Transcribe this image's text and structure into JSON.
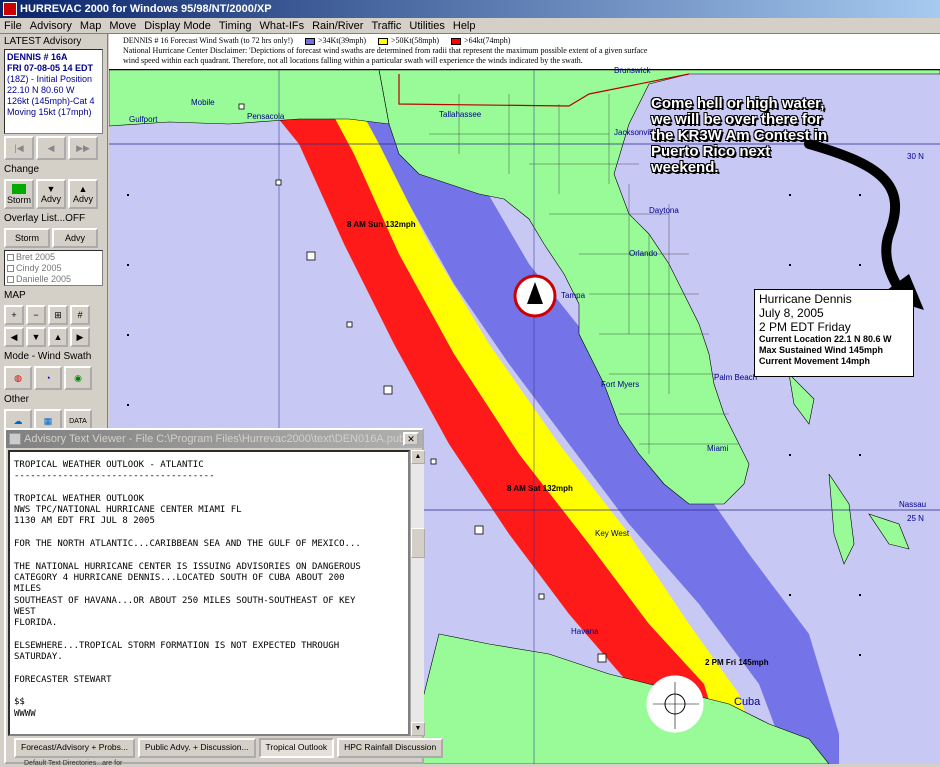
{
  "window": {
    "title": "HURREVAC 2000 for Windows 95/98/NT/2000/XP"
  },
  "menu": [
    "File",
    "Advisory",
    "Map",
    "Move",
    "Display Mode",
    "Timing",
    "What-IFs",
    "Rain/River",
    "Traffic",
    "Utilities",
    "Help"
  ],
  "left_panel": {
    "latest_label": "LATEST Advisory",
    "advisory_lines": [
      "DENNIS     # 16A",
      "FRI 07-08-05 14 EDT",
      "(18Z) - Initial Position",
      "22.10 N  80.60 W",
      "126kt (145mph)-Cat 4",
      "Moving 15kt (17mph)"
    ],
    "change_label": "Change",
    "change_buttons": [
      "Storm",
      "Advy",
      "Advy"
    ],
    "overlay_label": "Overlay List...OFF",
    "overlay_buttons": [
      "Storm",
      "Advy"
    ],
    "storms": [
      "Bret 2005",
      "Cindy 2005",
      "Danielle 2005"
    ],
    "map_label": "MAP",
    "mode_label": "Mode - Wind Swath",
    "other_label": "Other"
  },
  "disclaimer": {
    "heading": "DENNIS # 16     Forecast Wind Swath (to 72 hrs only!)",
    "legend": [
      {
        "label": ">34Kt(39mph)",
        "color": "#7070e0"
      },
      {
        "label": ">50Kt(58mph)",
        "color": "#ffff00"
      },
      {
        "label": ">64kt(74mph)",
        "color": "#ff0000"
      }
    ],
    "text1": "National Hurricane Center Disclaimer:  'Depictions of forecast wind swaths are determined from radii that represent the maximum possible extent of a given surface",
    "text2": "wind speed within each quadrant.  Therefore, not all locations falling within a particular swath will experience the winds indicated by the swath."
  },
  "map": {
    "cities": [
      "Mobile",
      "Pensacola",
      "Gulfport",
      "Tallahassee",
      "Jacksonville",
      "Daytona",
      "Orlando",
      "Tampa",
      "Fort Myers",
      "Palm Beach",
      "Miami",
      "Key West",
      "Havana",
      "Nassau",
      "Cuba",
      "Brunswick"
    ],
    "lat_labels": [
      "30 N",
      "25 N"
    ],
    "forecast_labels": [
      "8 AM  Sun 132mph",
      "8 AM  Sat 132mph",
      "2 PM  Fri 145mph"
    ]
  },
  "callout": {
    "text": "Come hell or high water, we will be over there for the KR3W Am Contest in Puerto Rico next weekend."
  },
  "info_box": {
    "name": "Hurricane Dennis",
    "date": "July 8, 2005",
    "time": "2 PM EDT Friday",
    "location": "Current Location 22.1 N  80.6 W",
    "wind": "Max Sustained Wind 145mph",
    "movement": "Current Movement 14mph"
  },
  "viewer": {
    "title": "Advisory Text Viewer - File C:\\Program Files\\Hurrevac2000\\text\\DEN016A.pub",
    "text": "TROPICAL WEATHER OUTLOOK - ATLANTIC\n-------------------------------------\n\nTROPICAL WEATHER OUTLOOK\nNWS TPC/NATIONAL HURRICANE CENTER MIAMI FL\n1130 AM EDT FRI JUL 8 2005\n\nFOR THE NORTH ATLANTIC...CARIBBEAN SEA AND THE GULF OF MEXICO...\n\nTHE NATIONAL HURRICANE CENTER IS ISSUING ADVISORIES ON DANGEROUS\nCATEGORY 4 HURRICANE DENNIS...LOCATED SOUTH OF CUBA ABOUT 200\nMILES\nSOUTHEAST OF HAVANA...OR ABOUT 250 MILES SOUTH-SOUTHEAST OF KEY\nWEST\nFLORIDA.\n\nELSEWHERE...TROPICAL STORM FORMATION IS NOT EXPECTED THROUGH\nSATURDAY.\n\nFORECASTER STEWART\n\n$$\nWWWW",
    "tabs": [
      "Forecast/Advisory + Probs...",
      "Public Advy. + Discussion...",
      "Tropical Outlook",
      "HPC Rainfall Discussion"
    ],
    "status": "Default Text Directories...are for"
  }
}
